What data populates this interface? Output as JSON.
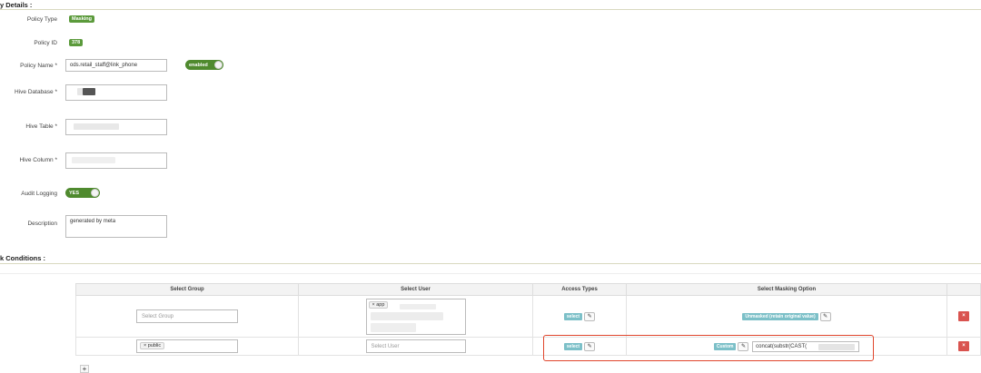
{
  "details": {
    "section_title": "y Details :",
    "policy_type": {
      "label": "Policy Type",
      "value": "Masking"
    },
    "policy_id": {
      "label": "Policy ID",
      "value": "378"
    },
    "policy_name": {
      "label": "Policy Name *",
      "value": "ods.retail_staff@link_phone",
      "toggle": "enabled"
    },
    "hive_database": {
      "label": "Hive Database *"
    },
    "hive_table": {
      "label": "Hive Table *"
    },
    "hive_column": {
      "label": "Hive Column *"
    },
    "audit_logging": {
      "label": "Audit Logging",
      "toggle": "YES"
    },
    "description": {
      "label": "Description",
      "value": "generated by meta"
    }
  },
  "conditions": {
    "section_title": "k Conditions :",
    "headers": [
      "Select Group",
      "Select User",
      "Access Types",
      "Select Masking Option"
    ],
    "rows": [
      {
        "group_placeholder": "Select Group",
        "user_chip": "app",
        "access_type": "select",
        "masking": "Unmasked (retain original value)"
      },
      {
        "group_chip": "public",
        "user_placeholder": "Select User",
        "access_type": "select",
        "masking": "Custom",
        "custom_expr": "concat(substr(CAST("
      }
    ],
    "remove_label": "×",
    "add_label": "+",
    "chip_remove": "×",
    "edit_label": "✎"
  }
}
